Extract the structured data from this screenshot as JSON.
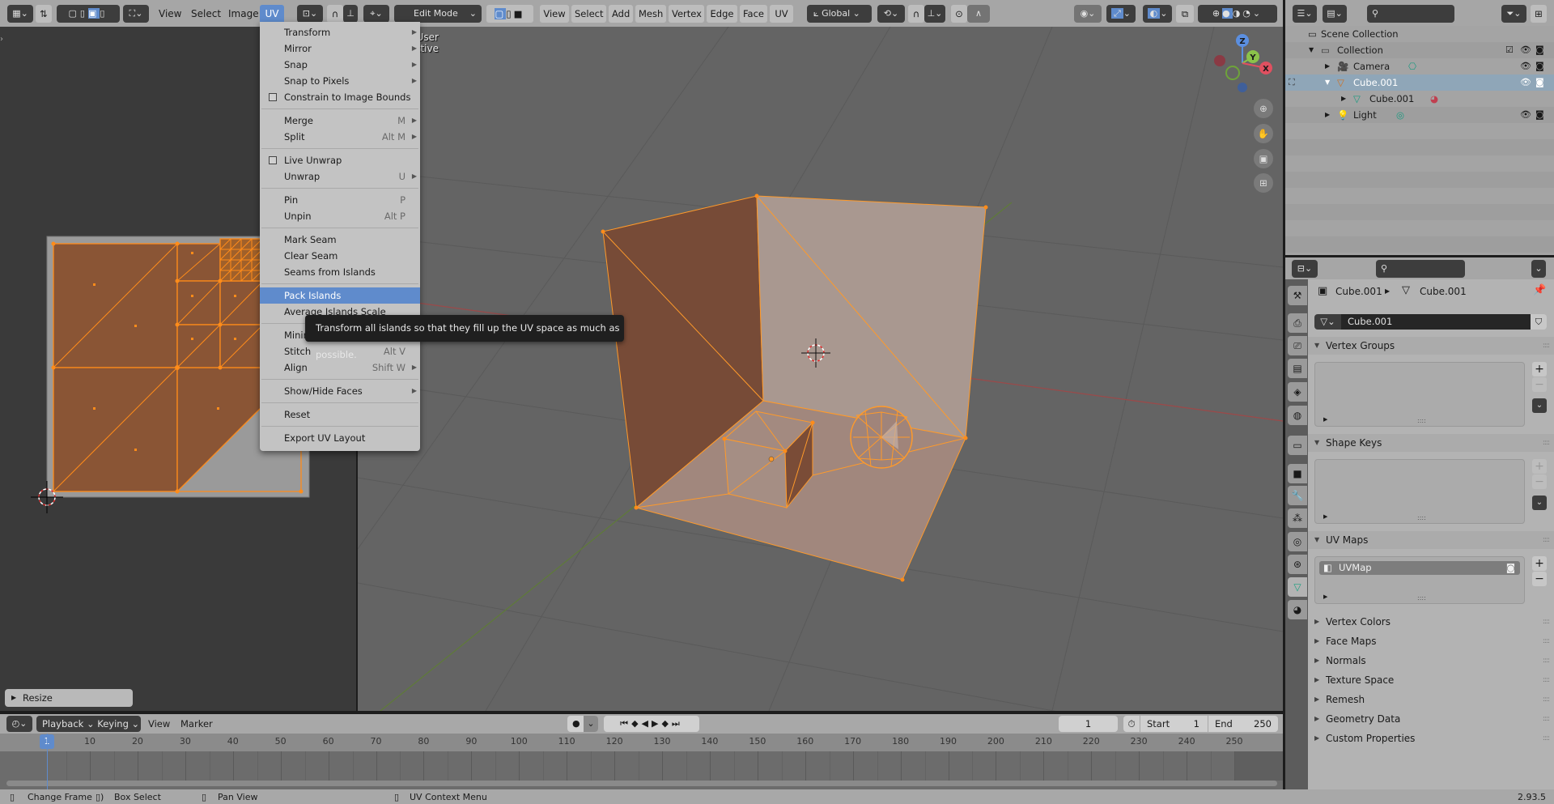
{
  "top_header": {
    "uv_editor_menus": [
      "View",
      "Select",
      "Image",
      "UV"
    ],
    "active_menu": "UV",
    "mode_dropdown": "Edit Mode",
    "viewport_menus": [
      "View",
      "Select",
      "Add",
      "Mesh",
      "Vertex",
      "Edge",
      "Face",
      "UV"
    ],
    "transform_orientation": "Global"
  },
  "uv_menu": {
    "items": [
      {
        "label": "Transform",
        "submenu": true
      },
      {
        "label": "Mirror",
        "submenu": true
      },
      {
        "label": "Snap",
        "submenu": true
      },
      {
        "label": "Snap to Pixels",
        "submenu": true
      },
      {
        "label": "Constrain to Image Bounds",
        "checkbox": true,
        "checked": false
      },
      {
        "sep": true
      },
      {
        "label": "Merge",
        "shortcut": "M",
        "submenu": true
      },
      {
        "label": "Split",
        "shortcut": "Alt M",
        "submenu": true
      },
      {
        "sep": true
      },
      {
        "label": "Live Unwrap",
        "checkbox": true,
        "checked": false
      },
      {
        "label": "Unwrap",
        "shortcut": "U",
        "submenu": true
      },
      {
        "sep": true
      },
      {
        "label": "Pin",
        "shortcut": "P"
      },
      {
        "label": "Unpin",
        "shortcut": "Alt P"
      },
      {
        "sep": true
      },
      {
        "label": "Mark Seam"
      },
      {
        "label": "Clear Seam"
      },
      {
        "label": "Seams from Islands"
      },
      {
        "sep": true
      },
      {
        "label": "Pack Islands",
        "highlighted": true
      },
      {
        "label": "Average Islands Scale"
      },
      {
        "sep": true
      },
      {
        "label": "Minimize Stretch"
      },
      {
        "label": "Stitch",
        "shortcut": "Alt V"
      },
      {
        "label": "Align",
        "shortcut": "Shift W",
        "submenu": true
      },
      {
        "sep": true
      },
      {
        "label": "Show/Hide Faces",
        "submenu": true
      },
      {
        "sep": true
      },
      {
        "label": "Reset"
      },
      {
        "sep": true
      },
      {
        "label": "Export UV Layout"
      }
    ],
    "tooltip": "Transform all islands so that they fill up the UV space as much as possible."
  },
  "uv_editor": {
    "last_operator_panel": "Resize"
  },
  "viewport": {
    "overlay_text": "User Perspective",
    "gizmo_axes": [
      "Z",
      "Y",
      "X"
    ]
  },
  "outliner": {
    "root": "Scene Collection",
    "rows": [
      {
        "label": "Collection",
        "expanded": true
      },
      {
        "label": "Camera"
      },
      {
        "label": "Cube.001",
        "selected": true,
        "expanded": true
      },
      {
        "label": "Cube.001"
      },
      {
        "label": "Light"
      }
    ]
  },
  "properties": {
    "breadcrumb": [
      "Cube.001",
      "Cube.001"
    ],
    "data_name": "Cube.001",
    "panels": {
      "vertex_groups": "Vertex Groups",
      "shape_keys": "Shape Keys",
      "uv_maps": "UV Maps",
      "uv_map_item": "UVMap",
      "collapsed": [
        "Vertex Colors",
        "Face Maps",
        "Normals",
        "Texture Space",
        "Remesh",
        "Geometry Data",
        "Custom Properties"
      ]
    }
  },
  "timeline": {
    "menus": [
      "Playback",
      "Keying",
      "View",
      "Marker"
    ],
    "current_frame": "1",
    "start_label": "Start",
    "start": "1",
    "end_label": "End",
    "end": "250",
    "ruler_ticks": [
      "1",
      "10",
      "20",
      "30",
      "40",
      "50",
      "60",
      "70",
      "80",
      "90",
      "100",
      "110",
      "120",
      "130",
      "140",
      "150",
      "160",
      "170",
      "180",
      "190",
      "200",
      "210",
      "220",
      "230",
      "240",
      "250"
    ]
  },
  "status_bar": {
    "hints": [
      "Change Frame",
      "Box Select",
      "Pan View",
      "UV Context Menu"
    ],
    "version": "2.93.5"
  },
  "colors": {
    "accent": "#5f8bcc",
    "selection_orange": "#ff8c1a",
    "face_brown": "#8a5535"
  }
}
